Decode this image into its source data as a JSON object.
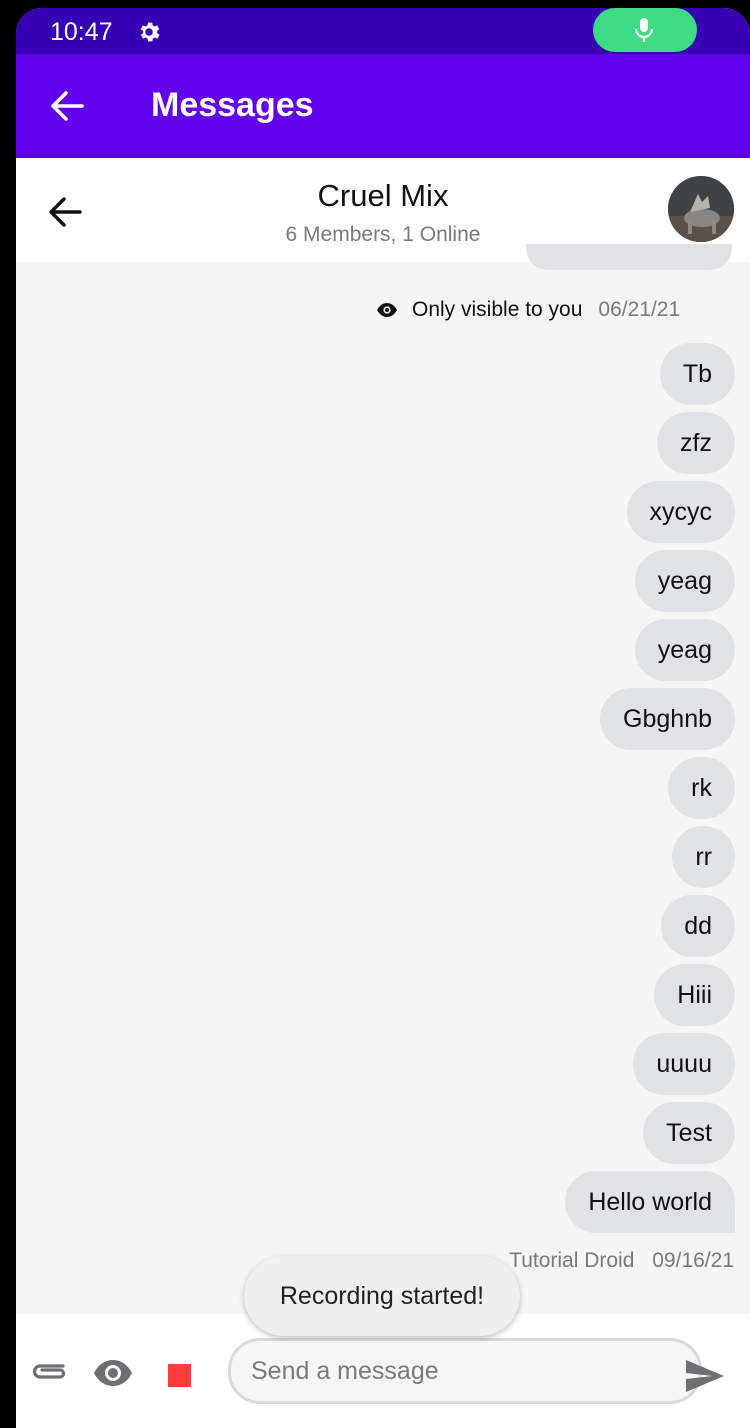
{
  "status_bar": {
    "time": "10:47"
  },
  "app_bar": {
    "title": "Messages"
  },
  "channel": {
    "name": "Cruel Mix",
    "subtitle": "6 Members, 1 Online"
  },
  "visibility_note": {
    "text": "Only visible to you",
    "date": "06/21/21"
  },
  "messages": [
    "Tb",
    "zfz",
    "xycyc",
    "yeag",
    "yeag",
    "Gbghnb",
    "rk",
    "rr",
    "dd",
    "Hiii",
    "uuuu",
    "Test",
    "Hello world"
  ],
  "message_meta": {
    "author": "Tutorial Droid",
    "date": "09/16/21"
  },
  "toast": {
    "text": "Recording started!"
  },
  "composer": {
    "placeholder": "Send a message"
  },
  "colors": {
    "status_bar": "#3700b3",
    "app_bar": "#6200ee",
    "mic_pill": "#3ddc84",
    "bubble": "#e1e2e6",
    "stop": "#ff3b3b"
  }
}
